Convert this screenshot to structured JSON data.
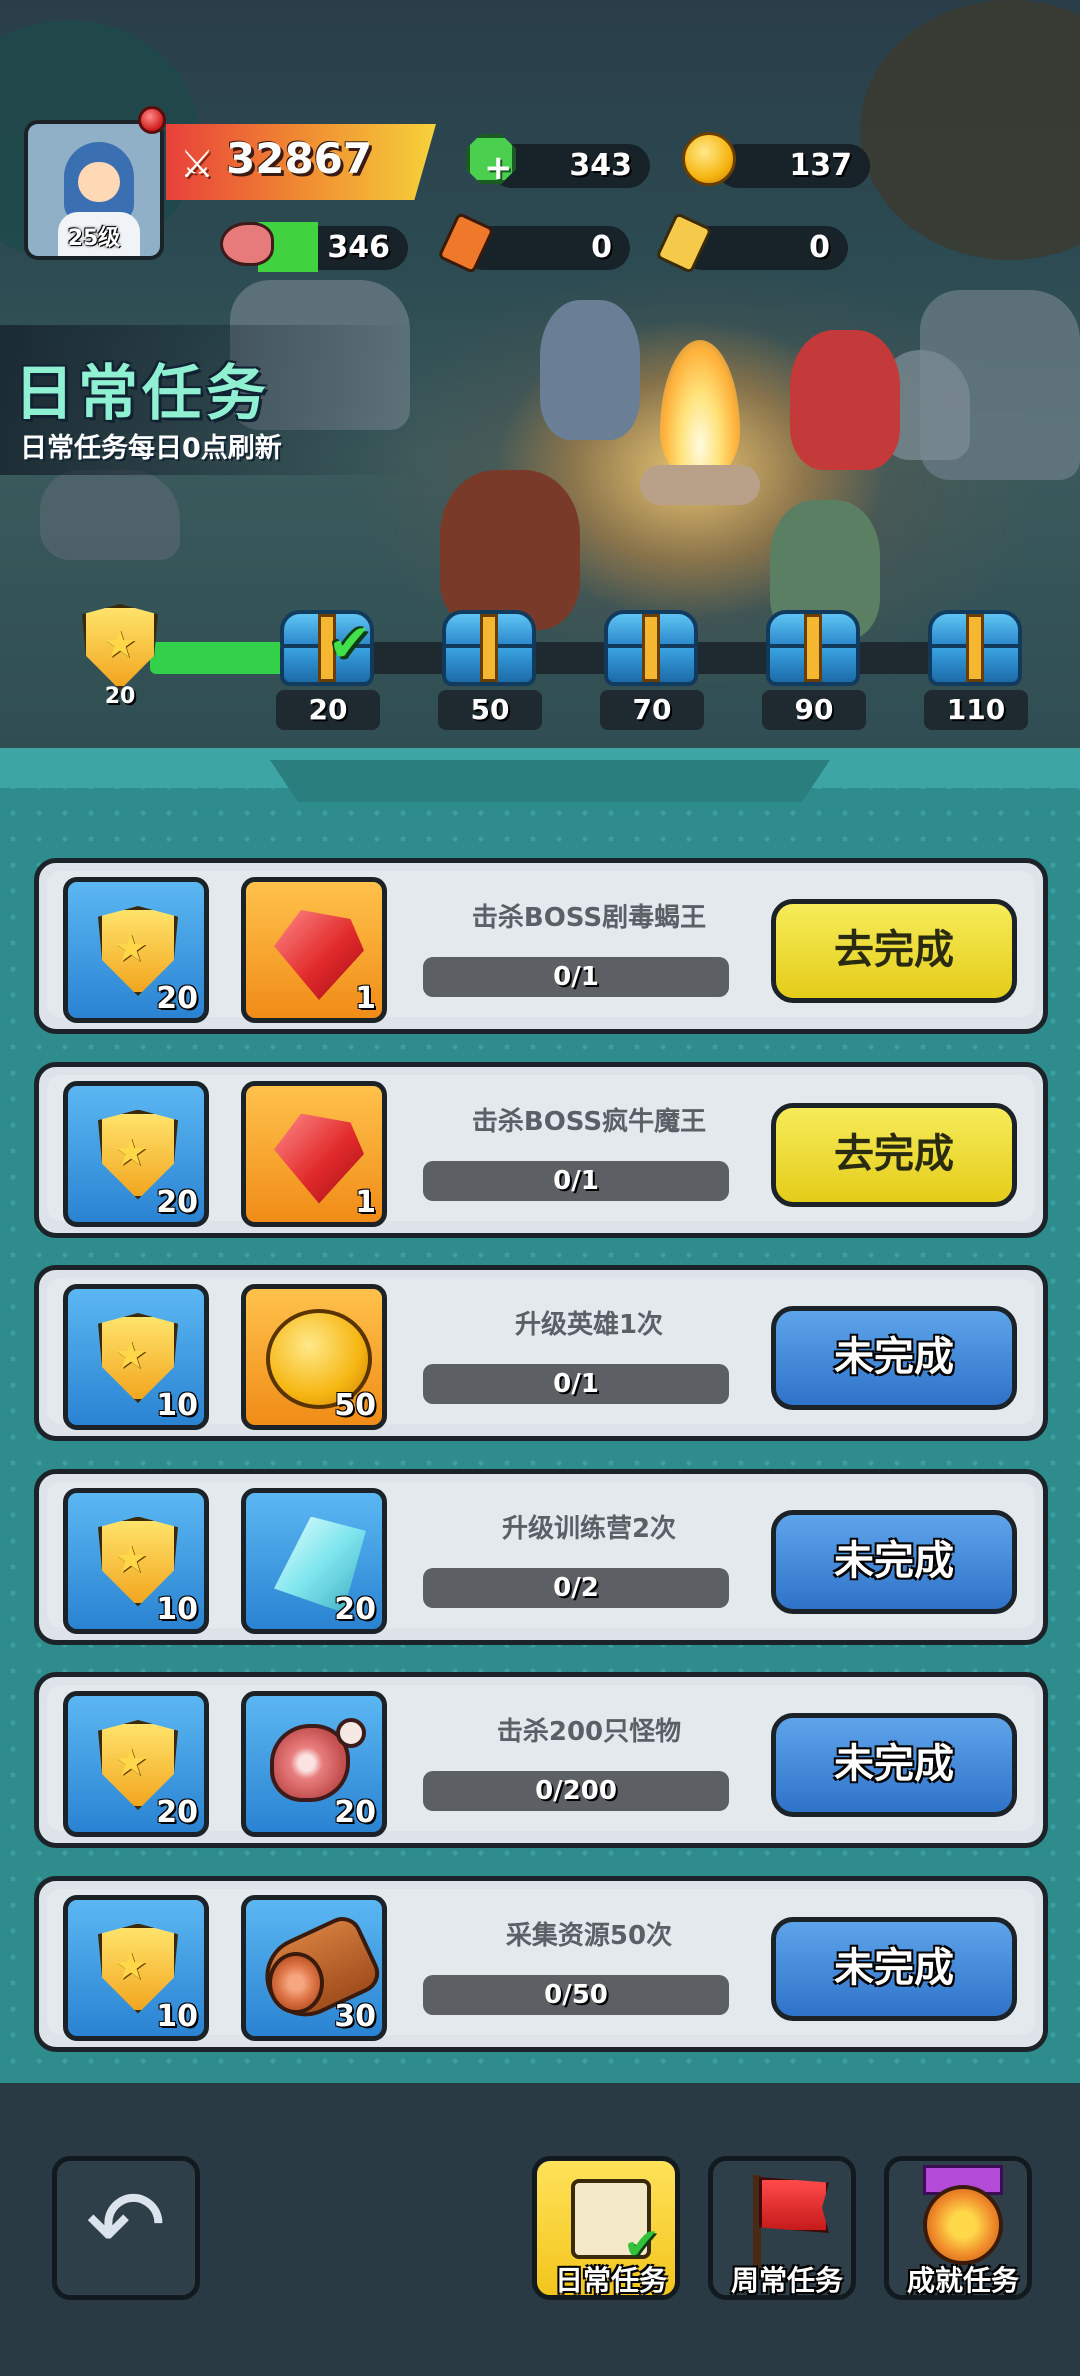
{
  "header": {
    "avatar_level": "25级",
    "power": "32867",
    "resources": {
      "gems": "343",
      "gold": "137",
      "stamina": "346",
      "red_ticket": "0",
      "gold_ticket": "0"
    }
  },
  "title": {
    "main": "日常任务",
    "sub": "日常任务每日0点刷新"
  },
  "milestones": {
    "current_points": "20",
    "progress_fraction": 0.2,
    "chests": [
      "20",
      "50",
      "70",
      "90",
      "110"
    ]
  },
  "tasks": [
    {
      "reward1_count": "20",
      "reward2_icon": "ruby-icon",
      "reward2_count": "1",
      "text": "击杀BOSS剧毒蝎王",
      "progress": "0/1",
      "button": "去完成",
      "button_style": "yellow"
    },
    {
      "reward1_count": "20",
      "reward2_icon": "ruby-icon",
      "reward2_count": "1",
      "text": "击杀BOSS疯牛魔王",
      "progress": "0/1",
      "button": "去完成",
      "button_style": "yellow"
    },
    {
      "reward1_count": "10",
      "reward2_icon": "coin-icon",
      "reward2_count": "50",
      "text": "升级英雄1次",
      "progress": "0/1",
      "button": "未完成",
      "button_style": "blue"
    },
    {
      "reward1_count": "10",
      "reward2_icon": "crystal-icon",
      "reward2_count": "20",
      "text": "升级训练营2次",
      "progress": "0/2",
      "button": "未完成",
      "button_style": "blue"
    },
    {
      "reward1_count": "20",
      "reward2_icon": "meat-icon",
      "reward2_count": "20",
      "text": "击杀200只怪物",
      "progress": "0/200",
      "button": "未完成",
      "button_style": "blue"
    },
    {
      "reward1_count": "10",
      "reward2_icon": "log-icon",
      "reward2_count": "30",
      "text": "采集资源50次",
      "progress": "0/50",
      "button": "未完成",
      "button_style": "blue"
    }
  ],
  "bottom_nav": {
    "back_icon": "back-arrow-icon",
    "tabs": [
      {
        "label": "日常任务",
        "icon": "daily-task-icon",
        "active": true
      },
      {
        "label": "周常任务",
        "icon": "flag-icon",
        "active": false
      },
      {
        "label": "成就任务",
        "icon": "medal-icon",
        "active": false
      }
    ]
  },
  "colors": {
    "accent_green": "#33d04a",
    "button_yellow": "#f6ec5a",
    "button_blue": "#2f73c9",
    "panel_teal": "#2f8c8c"
  }
}
